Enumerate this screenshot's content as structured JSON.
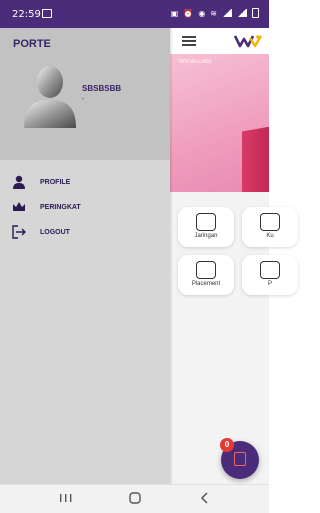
{
  "status_bar": {
    "time": "22:59",
    "battery": "▮"
  },
  "drawer": {
    "title": "PORTE",
    "user": {
      "name": "SBSBSBB",
      "subtitle": "-"
    },
    "menu": [
      {
        "label": "PROFILE",
        "icon": "person-icon"
      },
      {
        "label": "PERINGKAT",
        "icon": "crown-icon"
      },
      {
        "label": "LOGOUT",
        "icon": "logout-icon"
      }
    ]
  },
  "main": {
    "banner_tag": "TIRTA WALLINDO",
    "tiles": [
      {
        "label": "Jaringan",
        "icon": "network-icon"
      },
      {
        "label": "Ku",
        "icon": "tile-icon"
      },
      {
        "label": "Placement",
        "icon": "placement-icon"
      },
      {
        "label": "P",
        "icon": "tile-icon"
      }
    ],
    "fab_badge": "0"
  },
  "colors": {
    "status_bar": "#4a2c7a",
    "drawer_bg": "#d6d6d6",
    "drawer_header": "#c2c2c2",
    "accent": "#3a2466",
    "badge": "#e53935"
  }
}
